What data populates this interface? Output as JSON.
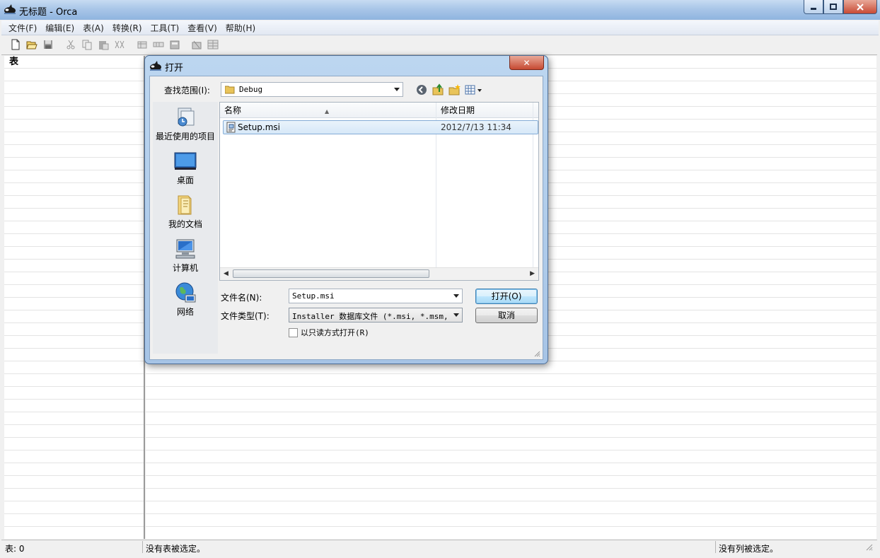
{
  "window": {
    "title": "无标题 - Orca"
  },
  "menu": [
    "文件(F)",
    "编辑(E)",
    "表(A)",
    "转换(R)",
    "工具(T)",
    "查看(V)",
    "帮助(H)"
  ],
  "tables_pane": {
    "header": "表"
  },
  "status": {
    "table_count": "表: 0",
    "no_table": "没有表被选定。",
    "no_column": "没有列被选定。"
  },
  "dialog": {
    "title": "打开",
    "close_glyph": "✕",
    "look_in_label": "查找范围(I):",
    "look_in_value": "Debug",
    "places": [
      "最近使用的项目",
      "桌面",
      "我的文档",
      "计算机",
      "网络"
    ],
    "columns": {
      "name": "名称",
      "date": "修改日期"
    },
    "files": [
      {
        "name": "Setup.msi",
        "date": "2012/7/13 11:34"
      }
    ],
    "filename_label": "文件名(N):",
    "filename_value": "Setup.msi",
    "filetype_label": "文件类型(T):",
    "filetype_value": "Installer 数据库文件 (*.msi, *.msm, *",
    "readonly_label": "以只读方式打开(R)",
    "open_button": "打开(O)",
    "cancel_button": "取消"
  }
}
